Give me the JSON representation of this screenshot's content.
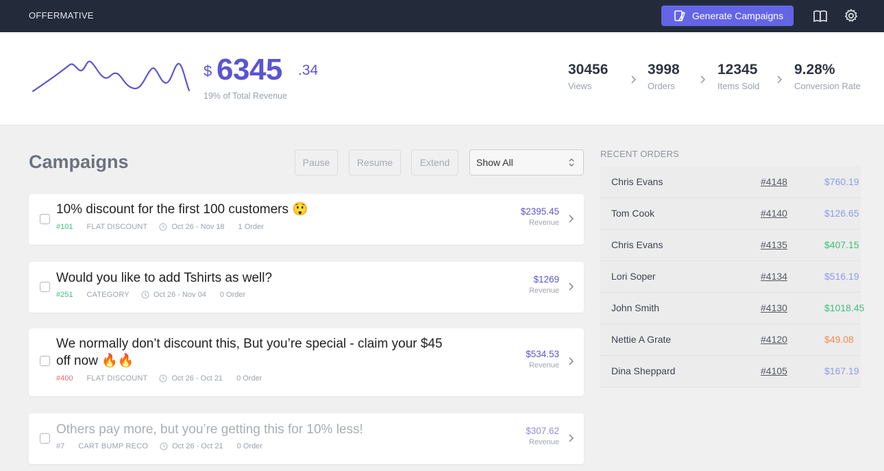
{
  "topbar": {
    "brand": "OFFERMATIVE",
    "generate_label": "Generate Campaigns",
    "icons": [
      "generate-icon",
      "book-icon",
      "gear-icon"
    ],
    "accent_color": "#6464e6",
    "bar_color": "#232b3b"
  },
  "revenue": {
    "currency": "$",
    "whole": "6345",
    "cents": ".34",
    "subtitle": "19% of Total Revenue",
    "color": "#5b55d0"
  },
  "metrics": [
    {
      "value": "30456",
      "label": "Views"
    },
    {
      "value": "3998",
      "label": "Orders"
    },
    {
      "value": "12345",
      "label": "Items Sold"
    },
    {
      "value": "9.28%",
      "label": "Conversion Rate"
    }
  ],
  "campaigns": {
    "title": "Campaigns",
    "buttons": {
      "pause": "Pause",
      "resume": "Resume",
      "extend": "Extend"
    },
    "filter": {
      "selected": "Show All"
    },
    "items": [
      {
        "title": "10% discount for the first 100 customers 😲",
        "id": "#101",
        "id_color": "#3cbf7a",
        "type": "FLAT DISCOUNT",
        "dates": "Oct 26 - Nov 18",
        "orders": "1 Order",
        "amount": "$2395.45",
        "amount_label": "Revenue"
      },
      {
        "title": "Would you like to add Tshirts as well?",
        "id": "#251",
        "id_color": "#3cbf7a",
        "type": "CATEGORY",
        "dates": "Oct 26 - Nov 04",
        "orders": "0 Order",
        "amount": "$1269",
        "amount_label": "Revenue"
      },
      {
        "title_line1": "We normally don’t discount this, But you’re special - claim your $45",
        "title_line2": "off now 🔥🔥",
        "id": "#400",
        "id_color": "#f06a6a",
        "type": "FLAT DISCOUNT",
        "dates": "Oct 26 - Oct 21",
        "orders": "0 Order",
        "amount": "$534.53",
        "amount_label": "Revenue"
      },
      {
        "title": "Others pay more, but you’re getting this for 10% less!",
        "id": "#7",
        "id_color": "#9aa1ad",
        "type": "CART BUMP RECO",
        "dates": "Oct 26 - Oct 21",
        "orders": "0 Order",
        "amount": "$307.62",
        "amount_label": "Revenue"
      }
    ]
  },
  "recent_orders": {
    "title": "RECENT ORDERS",
    "rows": [
      {
        "name": "Chris Evans",
        "id": "#4148",
        "amount": "$760.19",
        "color": "#8c9be8"
      },
      {
        "name": "Tom Cook",
        "id": "#4140",
        "amount": "$126.65",
        "color": "#8c9be8"
      },
      {
        "name": "Chris Evans",
        "id": "#4135",
        "amount": "$407.15",
        "color": "#3cbf7a"
      },
      {
        "name": "Lori Soper",
        "id": "#4134",
        "amount": "$516.19",
        "color": "#8c9be8"
      },
      {
        "name": "John Smith",
        "id": "#4130",
        "amount": "$1018.45",
        "color": "#3cbf7a"
      },
      {
        "name": "Nettie A Grate",
        "id": "#4120",
        "amount": "$49.08",
        "color": "#f08a4b"
      },
      {
        "name": "Dina Sheppard",
        "id": "#4105",
        "amount": "$167.19",
        "color": "#8c9be8"
      }
    ]
  }
}
